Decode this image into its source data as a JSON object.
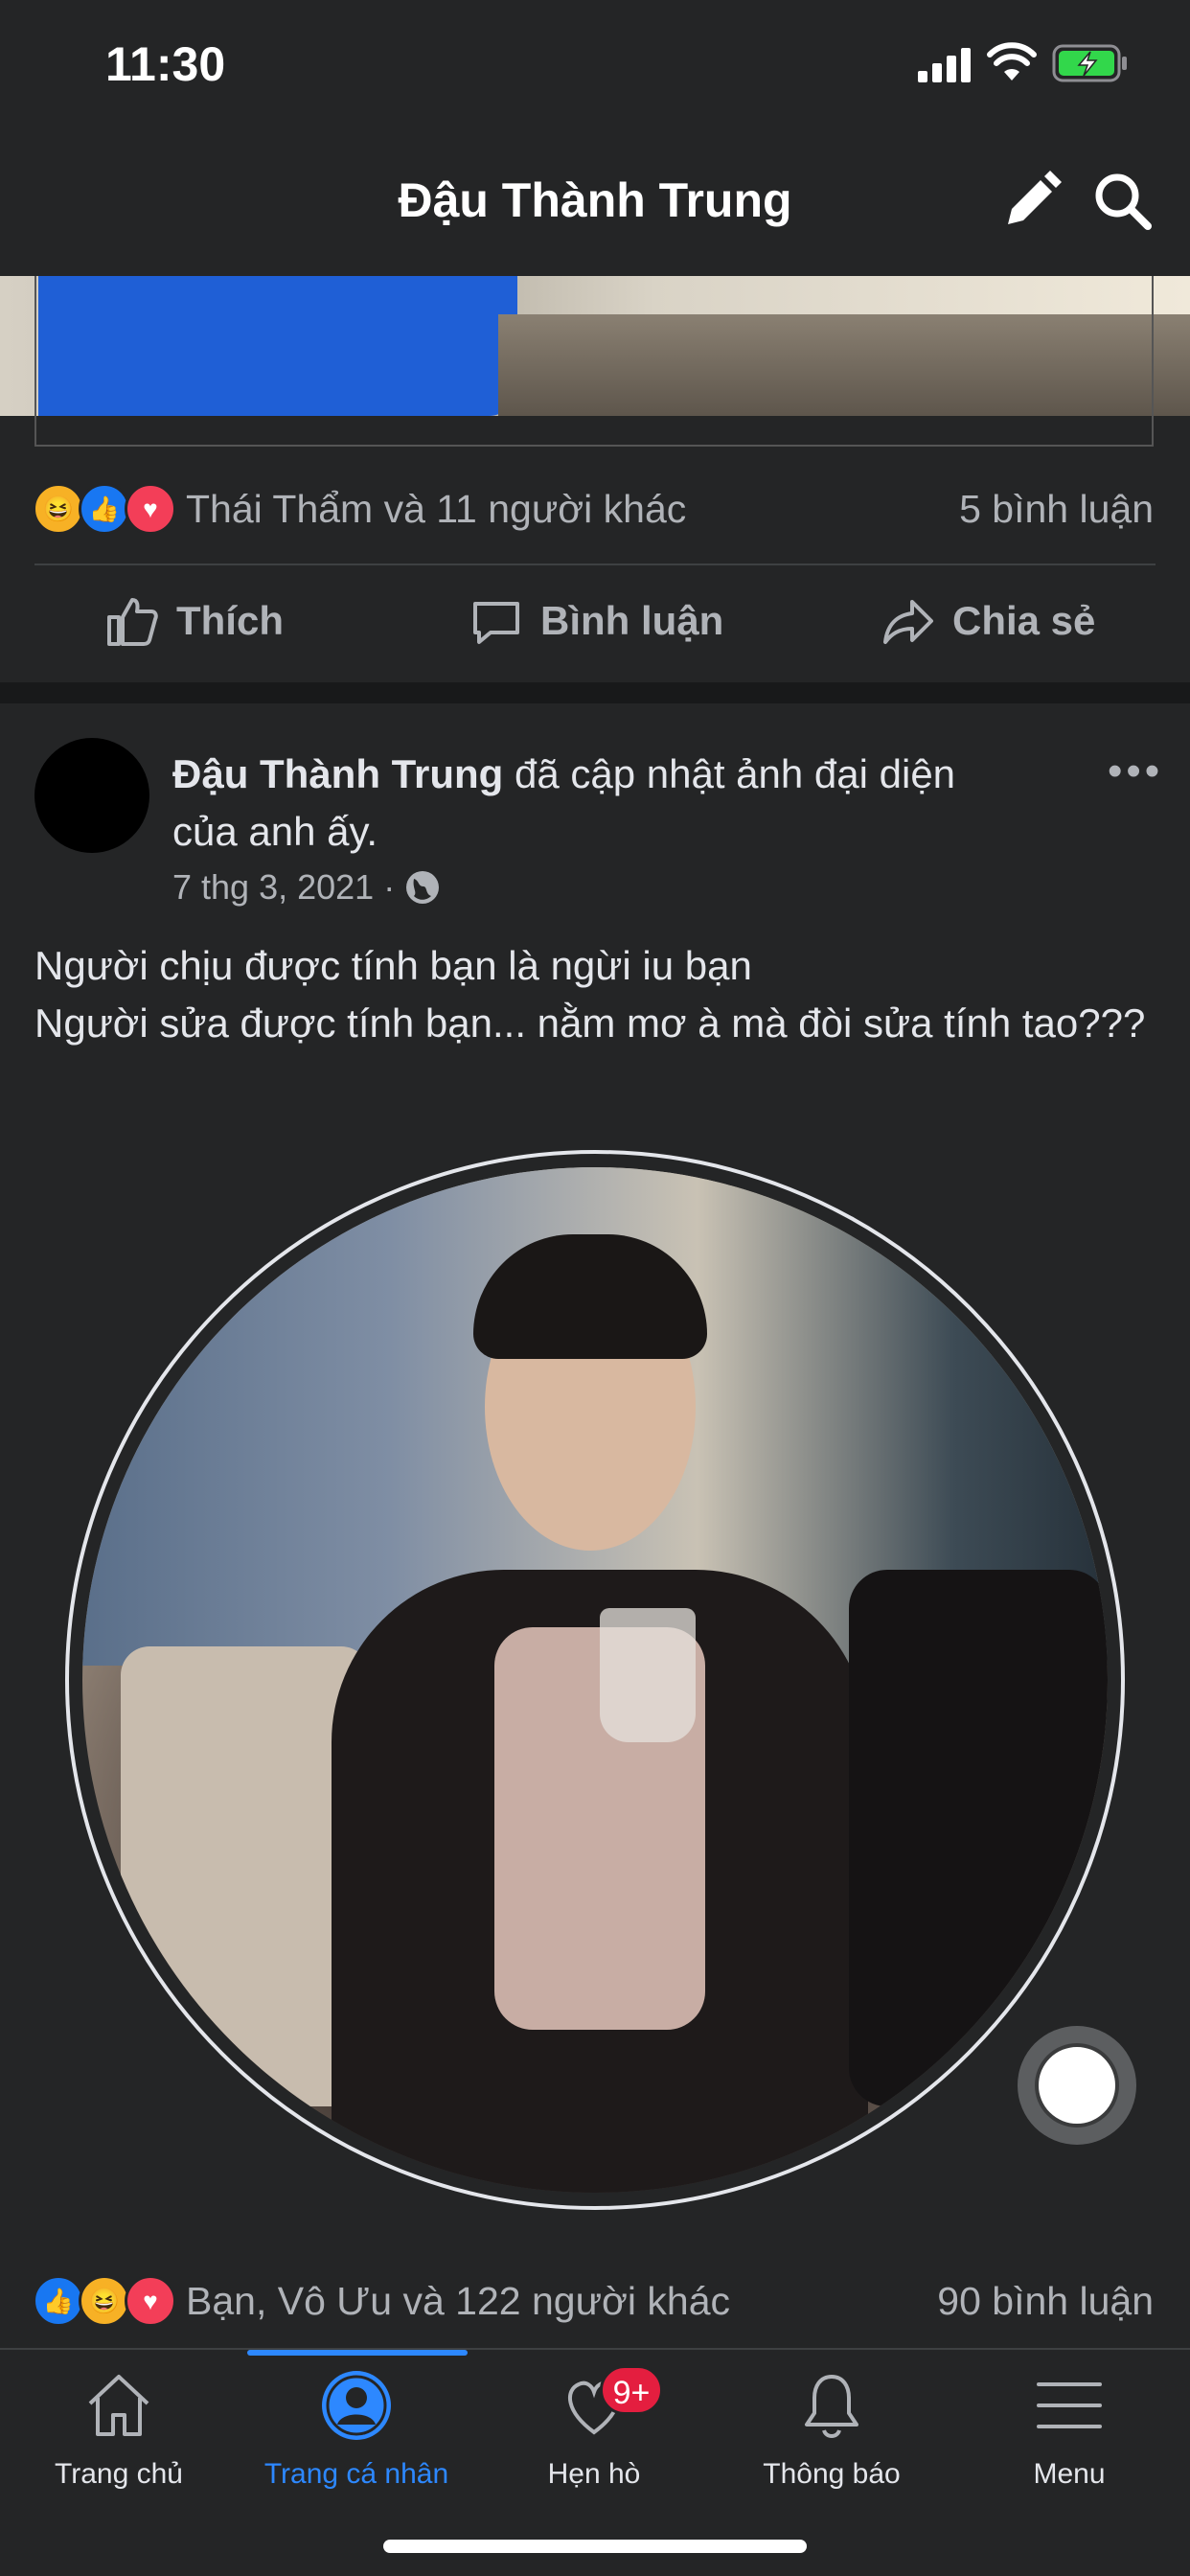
{
  "status_bar": {
    "time": "11:30"
  },
  "nav": {
    "title": "Đậu Thành Trung",
    "edit_icon": "pencil-icon",
    "search_icon": "search-icon"
  },
  "prev_post": {
    "reactions_text": "Thái Thẩm và 11 người khác",
    "comments": "5 bình luận",
    "actions": {
      "like": "Thích",
      "comment": "Bình luận",
      "share": "Chia sẻ"
    }
  },
  "post": {
    "author": "Đậu Thành Trung",
    "headline_rest": " đã cập nhật ảnh đại diện của anh ấy.",
    "date": "7 thg 3, 2021",
    "date_separator": "·",
    "more": "•••",
    "text_line1": "Người chịu được tính bạn là ngừi iu bạn",
    "text_line2": "Người sửa được tính bạn... nằm mơ à mà đòi sửa tính tao???",
    "reactions_text": "Bạn, Vô Ưu và 122 người khác",
    "comments": "90 bình luận"
  },
  "tabbar": {
    "items": [
      {
        "label": "Trang chủ",
        "icon": "home-icon"
      },
      {
        "label": "Trang cá nhân",
        "icon": "profile-icon",
        "active": true
      },
      {
        "label": "Hẹn hò",
        "icon": "heart-icon",
        "badge": "9+"
      },
      {
        "label": "Thông báo",
        "icon": "bell-icon"
      },
      {
        "label": "Menu",
        "icon": "menu-icon"
      }
    ]
  },
  "colors": {
    "background": "#242526",
    "accent": "#2d88ff",
    "badge": "#e41e3f"
  }
}
